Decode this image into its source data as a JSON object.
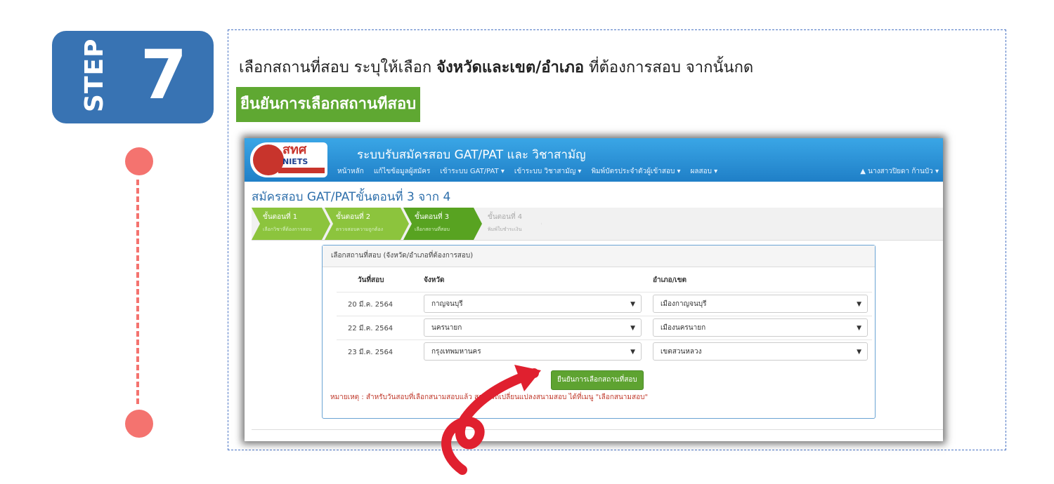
{
  "step": {
    "word": "STEP",
    "number": "7"
  },
  "instruction": {
    "prefix": "เลือกสถานที่สอบ ระบุให้เลือก ",
    "bold": "จังหวัดและเขต/อำเภอ",
    "suffix": " ที่ต้องการสอบ จากนั้นกด",
    "highlight": "ยืนยันการเลือกสถานทีสอบ"
  },
  "app": {
    "logo_text": "สทศ",
    "logo_sub": "NIETS",
    "system_title": "ระบบรับสมัครสอบ GAT/PAT และ วิชาสามัญ",
    "nav": [
      "หน้าหลัก",
      "แก้ไขข้อมูลผู้สมัคร",
      "เข้าระบบ GAT/PAT ▾",
      "เข้าระบบ วิชาสามัญ ▾",
      "พิมพ์บัตรประจำตัวผู้เข้าสอบ ▾",
      "ผลสอบ ▾"
    ],
    "user": "▲ นางสาวปิยดา ก้านบัว ▾",
    "page_title": "สมัครสอบ GAT/PATขั้นตอนที่ 3 จาก 4",
    "steps": [
      {
        "title": "ขั้นตอนที่ 1",
        "sub": "เลือกวิชาที่ต้องการสอบ"
      },
      {
        "title": "ขั้นตอนที่ 2",
        "sub": "ตรวจสอบความถูกต้อง"
      },
      {
        "title": "ขั้นตอนที่ 3",
        "sub": "เลือกสถานที่สอบ"
      },
      {
        "title": "ขั้นตอนที่ 4",
        "sub": "พิมพ์ใบชำระเงิน"
      }
    ],
    "panel_title": "เลือกสถานที่สอบ (จังหวัด/อำเภอที่ต้องการสอบ)",
    "columns": {
      "date": "วันที่สอบ",
      "province": "จังหวัด",
      "district": "อำเภอ/เขต"
    },
    "rows": [
      {
        "date": "20 มี.ค. 2564",
        "province": "กาญจนบุรี",
        "district": "เมืองกาญจนบุรี"
      },
      {
        "date": "22 มี.ค. 2564",
        "province": "นครนายก",
        "district": "เมืองนครนายก"
      },
      {
        "date": "23 มี.ค. 2564",
        "province": "กรุงเทพมหานคร",
        "district": "เขตสวนหลวง"
      }
    ],
    "confirm_button": "ยืนยันการเลือกสถานที่สอบ",
    "note": "หมายเหตุ : สำหรับวันสอบที่เลือกสนามสอบแล้ว สามารถเปลี่ยนแปลงสนามสอบ ได้ที่เมนู \"เลือกสนามสอบ\""
  },
  "colors": {
    "badge": "#3873b3",
    "accent_green": "#5fa832",
    "dot": "#f4736f",
    "arrow": "#e0202f"
  }
}
